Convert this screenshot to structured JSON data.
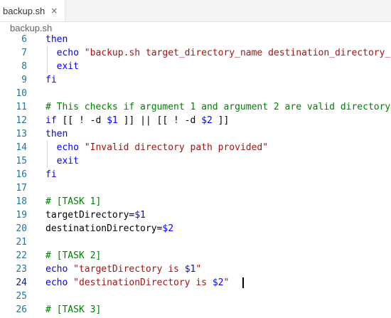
{
  "tab": {
    "label": "backup.sh",
    "close_glyph": "×"
  },
  "breadcrumb": {
    "file": "backup.sh"
  },
  "editor": {
    "lines": [
      {
        "num": "6",
        "t": [
          {
            "c": "kw",
            "s": "then"
          }
        ]
      },
      {
        "num": "7",
        "indent": true,
        "t": [
          {
            "c": "",
            "s": "  "
          },
          {
            "c": "kw",
            "s": "echo"
          },
          {
            "c": "",
            "s": " "
          },
          {
            "c": "str",
            "s": "\"backup.sh target_directory_name destination_directory_n"
          }
        ]
      },
      {
        "num": "8",
        "indent": true,
        "t": [
          {
            "c": "",
            "s": "  "
          },
          {
            "c": "kw",
            "s": "exit"
          }
        ]
      },
      {
        "num": "9",
        "t": [
          {
            "c": "kw",
            "s": "fi"
          }
        ]
      },
      {
        "num": "10",
        "t": []
      },
      {
        "num": "11",
        "t": [
          {
            "c": "cmt",
            "s": "# This checks if argument 1 and argument 2 are valid directory"
          }
        ]
      },
      {
        "num": "12",
        "t": [
          {
            "c": "kw",
            "s": "if"
          },
          {
            "c": "",
            "s": " [[ ! -d "
          },
          {
            "c": "var",
            "s": "$1"
          },
          {
            "c": "",
            "s": " ]] || [[ ! -d "
          },
          {
            "c": "var",
            "s": "$2"
          },
          {
            "c": "",
            "s": " ]]"
          }
        ]
      },
      {
        "num": "13",
        "t": [
          {
            "c": "kw",
            "s": "then"
          }
        ]
      },
      {
        "num": "14",
        "indent": true,
        "t": [
          {
            "c": "",
            "s": "  "
          },
          {
            "c": "kw",
            "s": "echo"
          },
          {
            "c": "",
            "s": " "
          },
          {
            "c": "str",
            "s": "\"Invalid directory path provided\""
          }
        ]
      },
      {
        "num": "15",
        "indent": true,
        "t": [
          {
            "c": "",
            "s": "  "
          },
          {
            "c": "kw",
            "s": "exit"
          }
        ]
      },
      {
        "num": "16",
        "t": [
          {
            "c": "kw",
            "s": "fi"
          }
        ]
      },
      {
        "num": "17",
        "t": []
      },
      {
        "num": "18",
        "t": [
          {
            "c": "cmt",
            "s": "# [TASK 1]"
          }
        ]
      },
      {
        "num": "19",
        "t": [
          {
            "c": "",
            "s": "targetDirectory="
          },
          {
            "c": "var",
            "s": "$1"
          }
        ]
      },
      {
        "num": "20",
        "t": [
          {
            "c": "",
            "s": "destinationDirectory="
          },
          {
            "c": "var",
            "s": "$2"
          }
        ]
      },
      {
        "num": "21",
        "t": []
      },
      {
        "num": "22",
        "t": [
          {
            "c": "cmt",
            "s": "# [TASK 2]"
          }
        ]
      },
      {
        "num": "23",
        "t": [
          {
            "c": "kw",
            "s": "echo"
          },
          {
            "c": "",
            "s": " "
          },
          {
            "c": "str",
            "s": "\"targetDirectory is "
          },
          {
            "c": "var",
            "s": "$1"
          },
          {
            "c": "str",
            "s": "\""
          }
        ]
      },
      {
        "num": "24",
        "active": true,
        "t": [
          {
            "c": "kw",
            "s": "echo"
          },
          {
            "c": "",
            "s": " "
          },
          {
            "c": "str",
            "s": "\"destinationDirectory is "
          },
          {
            "c": "var",
            "s": "$2"
          },
          {
            "c": "str",
            "s": "\""
          }
        ]
      },
      {
        "num": "25",
        "t": []
      },
      {
        "num": "26",
        "t": [
          {
            "c": "cmt",
            "s": "# [TASK 3]"
          }
        ]
      }
    ]
  }
}
